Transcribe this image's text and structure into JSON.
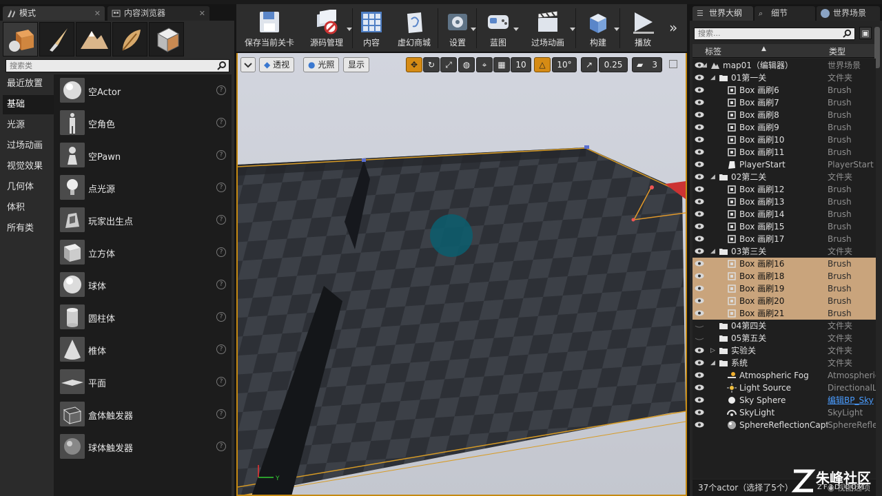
{
  "left_tabs": [
    {
      "label": "模式",
      "icon": "modes-icon"
    },
    {
      "label": "内容浏览器",
      "icon": "content-browser-icon"
    }
  ],
  "modes": {
    "mode_buttons": [
      {
        "name": "place-mode",
        "icon": "cube-sphere-icon"
      },
      {
        "name": "paint-mode",
        "icon": "brush-icon"
      },
      {
        "name": "landscape-mode",
        "icon": "mountain-icon"
      },
      {
        "name": "foliage-mode",
        "icon": "leaf-icon"
      },
      {
        "name": "geometry-mode",
        "icon": "geometry-cube-icon"
      }
    ],
    "search_placeholder": "搜索类",
    "categories": [
      "最近放置",
      "基础",
      "光源",
      "过场动画",
      "视觉效果",
      "几何体",
      "体积",
      "所有类"
    ],
    "active_category": "基础",
    "items": [
      {
        "label": "空Actor",
        "icon": "sphere-icon"
      },
      {
        "label": "空角色",
        "icon": "character-icon"
      },
      {
        "label": "空Pawn",
        "icon": "pawn-icon"
      },
      {
        "label": "点光源",
        "icon": "bulb-icon"
      },
      {
        "label": "玩家出生点",
        "icon": "player-start-icon"
      },
      {
        "label": "立方体",
        "icon": "cube-icon"
      },
      {
        "label": "球体",
        "icon": "sphere-icon"
      },
      {
        "label": "圆柱体",
        "icon": "cylinder-icon"
      },
      {
        "label": "椎体",
        "icon": "cone-icon"
      },
      {
        "label": "平面",
        "icon": "plane-icon"
      },
      {
        "label": "盒体触发器",
        "icon": "box-trigger-icon"
      },
      {
        "label": "球体触发器",
        "icon": "sphere-trigger-icon"
      }
    ],
    "help_glyph": "?"
  },
  "toolbar": [
    {
      "label": "保存当前关卡",
      "icon": "save-icon",
      "caret": false
    },
    {
      "label": "源码管理",
      "icon": "source-control-icon",
      "caret": true
    },
    {
      "label": "内容",
      "icon": "content-icon",
      "caret": false
    },
    {
      "label": "虚幻商城",
      "icon": "marketplace-icon",
      "caret": false
    },
    {
      "label": "设置",
      "icon": "settings-icon",
      "caret": true
    },
    {
      "label": "蓝图",
      "icon": "blueprint-icon",
      "caret": true
    },
    {
      "label": "过场动画",
      "icon": "cinematics-icon",
      "caret": true
    },
    {
      "label": "构建",
      "icon": "build-icon",
      "caret": true
    },
    {
      "label": "播放",
      "icon": "play-icon",
      "caret": false
    }
  ],
  "toolbar_more": "»",
  "viewport": {
    "buttons": {
      "perspective": "透视",
      "lit": "光照",
      "show": "显示"
    },
    "grid_snap": "10",
    "rotation_snap": "10°",
    "scale_snap": "0.25",
    "camera_speed": "3"
  },
  "right_tabs": [
    {
      "label": "世界大纲",
      "icon": "outliner-icon"
    },
    {
      "label": "细节",
      "icon": "details-icon"
    },
    {
      "label": "世界场景",
      "icon": "world-icon"
    }
  ],
  "outliner": {
    "search_placeholder": "搜索...",
    "col_label": "标签",
    "col_type": "类型",
    "rows": [
      {
        "name": "map01（编辑器）",
        "type": "世界场景",
        "depth": 0,
        "kind": "map",
        "expand": "open",
        "sel": false,
        "eye": true
      },
      {
        "name": "01第一关",
        "type": "文件夹",
        "depth": 1,
        "kind": "folder",
        "expand": "open",
        "sel": false,
        "eye": true
      },
      {
        "name": "Box 画刷6",
        "type": "Brush",
        "depth": 2,
        "kind": "brush",
        "expand": "",
        "sel": false,
        "eye": true
      },
      {
        "name": "Box 画刷7",
        "type": "Brush",
        "depth": 2,
        "kind": "brush",
        "expand": "",
        "sel": false,
        "eye": true
      },
      {
        "name": "Box 画刷8",
        "type": "Brush",
        "depth": 2,
        "kind": "brush",
        "expand": "",
        "sel": false,
        "eye": true
      },
      {
        "name": "Box 画刷9",
        "type": "Brush",
        "depth": 2,
        "kind": "brush",
        "expand": "",
        "sel": false,
        "eye": true
      },
      {
        "name": "Box 画刷10",
        "type": "Brush",
        "depth": 2,
        "kind": "brush",
        "expand": "",
        "sel": false,
        "eye": true
      },
      {
        "name": "Box 画刷11",
        "type": "Brush",
        "depth": 2,
        "kind": "brush",
        "expand": "",
        "sel": false,
        "eye": true
      },
      {
        "name": "PlayerStart",
        "type": "PlayerStart",
        "depth": 2,
        "kind": "player",
        "expand": "",
        "sel": false,
        "eye": true
      },
      {
        "name": "02第二关",
        "type": "文件夹",
        "depth": 1,
        "kind": "folder",
        "expand": "open",
        "sel": false,
        "eye": true
      },
      {
        "name": "Box 画刷12",
        "type": "Brush",
        "depth": 2,
        "kind": "brush",
        "expand": "",
        "sel": false,
        "eye": true
      },
      {
        "name": "Box 画刷13",
        "type": "Brush",
        "depth": 2,
        "kind": "brush",
        "expand": "",
        "sel": false,
        "eye": true
      },
      {
        "name": "Box 画刷14",
        "type": "Brush",
        "depth": 2,
        "kind": "brush",
        "expand": "",
        "sel": false,
        "eye": true
      },
      {
        "name": "Box 画刷15",
        "type": "Brush",
        "depth": 2,
        "kind": "brush",
        "expand": "",
        "sel": false,
        "eye": true
      },
      {
        "name": "Box 画刷17",
        "type": "Brush",
        "depth": 2,
        "kind": "brush",
        "expand": "",
        "sel": false,
        "eye": true
      },
      {
        "name": "03第三关",
        "type": "文件夹",
        "depth": 1,
        "kind": "folder",
        "expand": "open",
        "sel": false,
        "eye": true
      },
      {
        "name": "Box 画刷16",
        "type": "Brush",
        "depth": 2,
        "kind": "brush",
        "expand": "",
        "sel": true,
        "eye": true
      },
      {
        "name": "Box 画刷18",
        "type": "Brush",
        "depth": 2,
        "kind": "brush",
        "expand": "",
        "sel": true,
        "eye": true
      },
      {
        "name": "Box 画刷19",
        "type": "Brush",
        "depth": 2,
        "kind": "brush",
        "expand": "",
        "sel": true,
        "eye": true
      },
      {
        "name": "Box 画刷20",
        "type": "Brush",
        "depth": 2,
        "kind": "brush",
        "expand": "",
        "sel": true,
        "eye": true
      },
      {
        "name": "Box 画刷21",
        "type": "Brush",
        "depth": 2,
        "kind": "brush",
        "expand": "",
        "sel": true,
        "eye": true
      },
      {
        "name": "04第四关",
        "type": "文件夹",
        "depth": 1,
        "kind": "folder",
        "expand": "",
        "sel": false,
        "eye": false
      },
      {
        "name": "05第五关",
        "type": "文件夹",
        "depth": 1,
        "kind": "folder",
        "expand": "",
        "sel": false,
        "eye": false
      },
      {
        "name": "实验关",
        "type": "文件夹",
        "depth": 1,
        "kind": "folder",
        "expand": "closed",
        "sel": false,
        "eye": true
      },
      {
        "name": "系统",
        "type": "文件夹",
        "depth": 1,
        "kind": "folder",
        "expand": "open",
        "sel": false,
        "eye": true
      },
      {
        "name": "Atmospheric Fog",
        "type": "AtmosphericF",
        "depth": 2,
        "kind": "fog",
        "expand": "",
        "sel": false,
        "eye": true
      },
      {
        "name": "Light Source",
        "type": "DirectionalLig",
        "depth": 2,
        "kind": "sun",
        "expand": "",
        "sel": false,
        "eye": true
      },
      {
        "name": "Sky Sphere",
        "type": "编辑BP_Sky",
        "depth": 2,
        "kind": "sky",
        "expand": "",
        "sel": false,
        "eye": true,
        "link": true
      },
      {
        "name": "SkyLight",
        "type": "SkyLight",
        "depth": 2,
        "kind": "skylight",
        "expand": "",
        "sel": false,
        "eye": true
      },
      {
        "name": "SphereReflectionCapture",
        "type": "SphereReflec",
        "depth": 2,
        "kind": "reflect",
        "expand": "",
        "sel": false,
        "eye": true
      }
    ],
    "status": "37个actor（选择了5个）",
    "view_options": "视图选项"
  },
  "watermark": {
    "text": "朱峰社区",
    "sub": "ZF3D.COM"
  },
  "colors": {
    "accent": "#c68a12",
    "selection": "#c9a47c",
    "link": "#4a9cff"
  }
}
